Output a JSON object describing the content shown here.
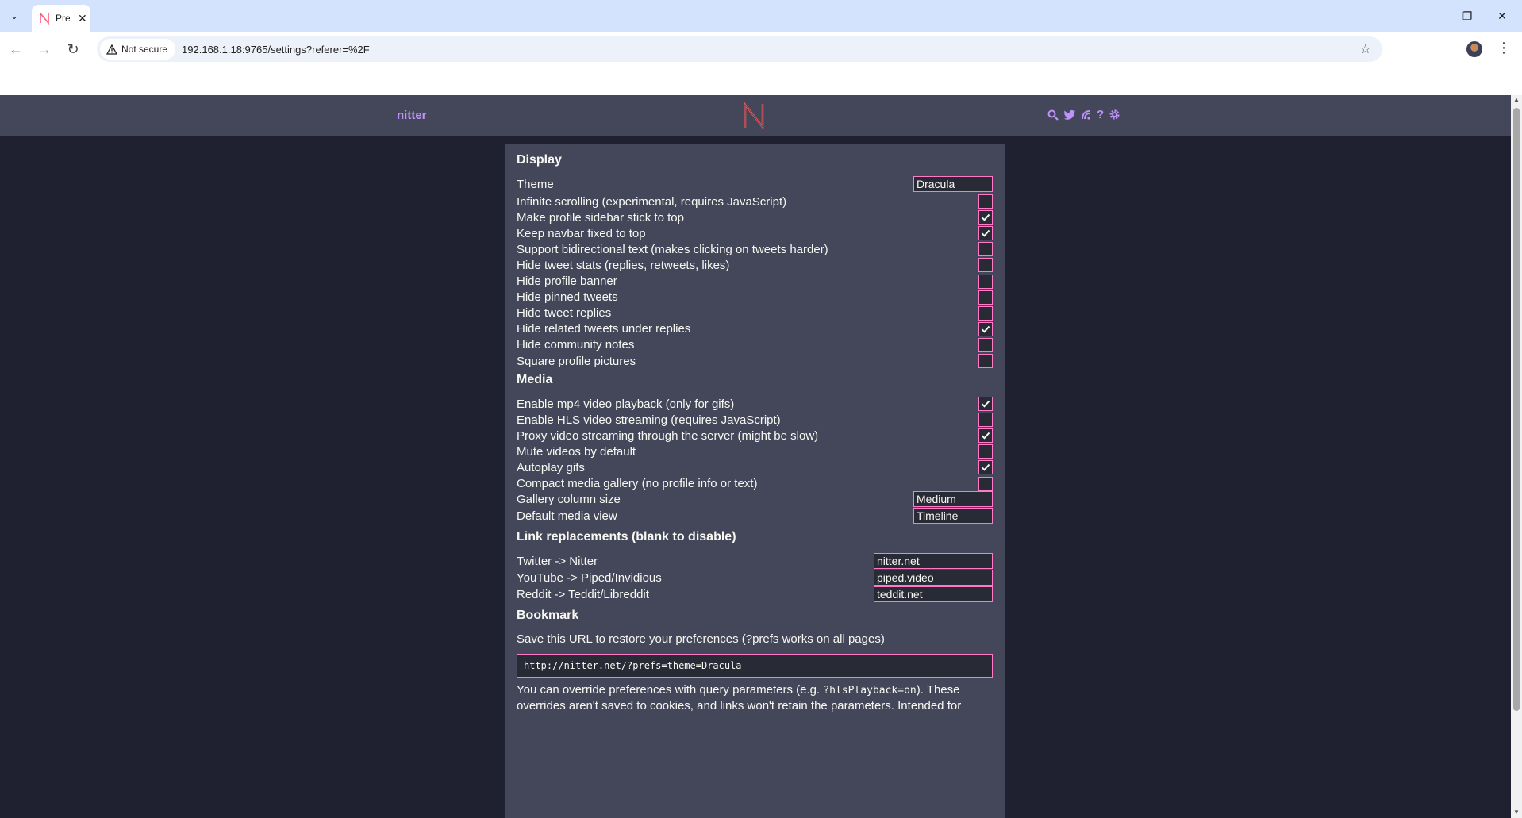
{
  "browser": {
    "tab_title": "Pre",
    "security_label": "Not secure",
    "url": "192.168.1.18:9765/settings?referer=%2F"
  },
  "navbar": {
    "site_name": "nitter",
    "help_label": "?"
  },
  "display": {
    "title": "Display",
    "theme_label": "Theme",
    "theme_value": "Dracula",
    "options": [
      {
        "label": "Infinite scrolling (experimental, requires JavaScript)",
        "checked": false
      },
      {
        "label": "Make profile sidebar stick to top",
        "checked": true
      },
      {
        "label": "Keep navbar fixed to top",
        "checked": true
      },
      {
        "label": "Support bidirectional text (makes clicking on tweets harder)",
        "checked": false
      },
      {
        "label": "Hide tweet stats (replies, retweets, likes)",
        "checked": false
      },
      {
        "label": "Hide profile banner",
        "checked": false
      },
      {
        "label": "Hide pinned tweets",
        "checked": false
      },
      {
        "label": "Hide tweet replies",
        "checked": false
      },
      {
        "label": "Hide related tweets under replies",
        "checked": true
      },
      {
        "label": "Hide community notes",
        "checked": false
      },
      {
        "label": "Square profile pictures",
        "checked": false
      }
    ]
  },
  "media": {
    "title": "Media",
    "options": [
      {
        "label": "Enable mp4 video playback (only for gifs)",
        "checked": true
      },
      {
        "label": "Enable HLS video streaming (requires JavaScript)",
        "checked": false
      },
      {
        "label": "Proxy video streaming through the server (might be slow)",
        "checked": true
      },
      {
        "label": "Mute videos by default",
        "checked": false
      },
      {
        "label": "Autoplay gifs",
        "checked": true
      },
      {
        "label": "Compact media gallery (no profile info or text)",
        "checked": false
      }
    ],
    "gallery_label": "Gallery column size",
    "gallery_value": "Medium",
    "view_label": "Default media view",
    "view_value": "Timeline"
  },
  "links": {
    "title": "Link replacements (blank to disable)",
    "twitter_label": "Twitter -> Nitter",
    "twitter_value": "nitter.net",
    "youtube_label": "YouTube -> Piped/Invidious",
    "youtube_value": "piped.video",
    "reddit_label": "Reddit -> Teddit/Libreddit",
    "reddit_value": "teddit.net"
  },
  "bookmark": {
    "title": "Bookmark",
    "description": "Save this URL to restore your preferences (?prefs works on all pages)",
    "url": "http://nitter.net/?prefs=theme=Dracula",
    "override_pre": "You can override preferences with query parameters (e.g. ",
    "override_code": "?hlsPlayback=on",
    "override_post": "). These overrides aren't saved to cookies, and links won't retain the parameters. Intended for"
  },
  "colors": {
    "accent": "#bd93f9",
    "border": "#ff79c6",
    "panel": "#44475a",
    "background": "#1f2130"
  }
}
